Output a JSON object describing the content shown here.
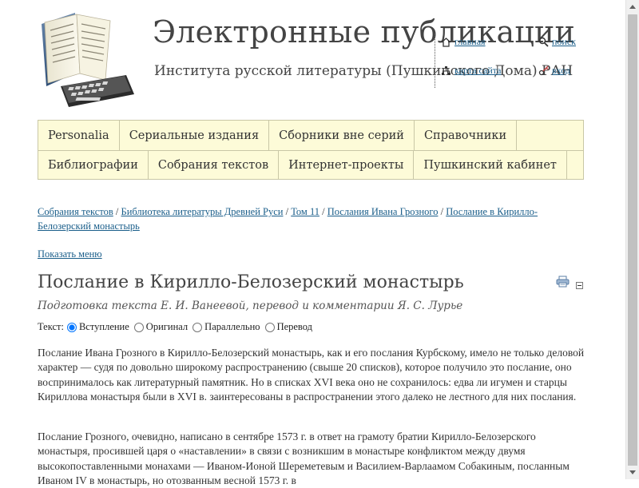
{
  "site": {
    "title": "Электронные публикации",
    "subtitle": "Института русской литературы (Пушкинского Дома) РАН"
  },
  "toplinks": {
    "home": "главная",
    "search": "поиск",
    "sitemap": "карта сайта",
    "login": "вход"
  },
  "nav": {
    "row1": [
      "Personalia",
      "Сериальные издания",
      "Сборники вне серий",
      "Справочники"
    ],
    "row2": [
      "Библиографии",
      "Собрания текстов",
      "Интернет-проекты",
      "Пушкинский кабинет"
    ]
  },
  "breadcrumb": {
    "items": [
      "Собрания текстов",
      "Библиотека литературы Древней Руси",
      "Том 11",
      "Послания Ивана Грозного",
      "Послание в Кирилло-Белозерский монастырь"
    ],
    "separator": "/"
  },
  "show_menu": "Показать меню",
  "page": {
    "title": "Послание в Кирилло-Белозерский монастырь",
    "credits": "Подготовка текста Е. И. Ванеевой, перевод и комментарии Я. С. Лурье"
  },
  "text_switch": {
    "label": "Текст:",
    "options": [
      "Вступление",
      "Оригинал",
      "Параллельно",
      "Перевод"
    ],
    "selected": "Вступление"
  },
  "paragraphs": [
    "Послание Ивана Грозного в Кирилло-Белозерский монастырь, как и его послания Курбскому, имело не только деловой характер — судя по довольно широкому распространению (свыше 20 списков), которое получило это послание, оно воспринималось как литературный памятник. Но в списках XVI века оно не сохранилось: едва ли игумен и старцы Кириллова монастыря были в XVI в. заинтересованы в распространении этого далеко не лестного для них послания.",
    "Послание Грозного, очевидно, написано в сентябре 1573 г. в ответ на грамоту братии Кирилло-Белозерского монастыря, просившей царя о «наставлении» в связи с возникшим в монастыре конфликтом между двумя высокопоставленными монахами — Иваном-Ионой Шереметевым и Василием-Варлаамом Собакиным, посланным Иваном IV в монастырь, но отозванным весной 1573 г. в"
  ],
  "colors": {
    "link": "#1a5e8a",
    "nav_bg": "#fdfbd8",
    "nav_border": "#c9c7a6",
    "title": "#444444",
    "text": "#333333"
  },
  "icons": [
    "book-keyboard-logo",
    "home-icon",
    "search-icon",
    "sitemap-icon",
    "login-icon",
    "print-icon",
    "collapse-icon"
  ]
}
